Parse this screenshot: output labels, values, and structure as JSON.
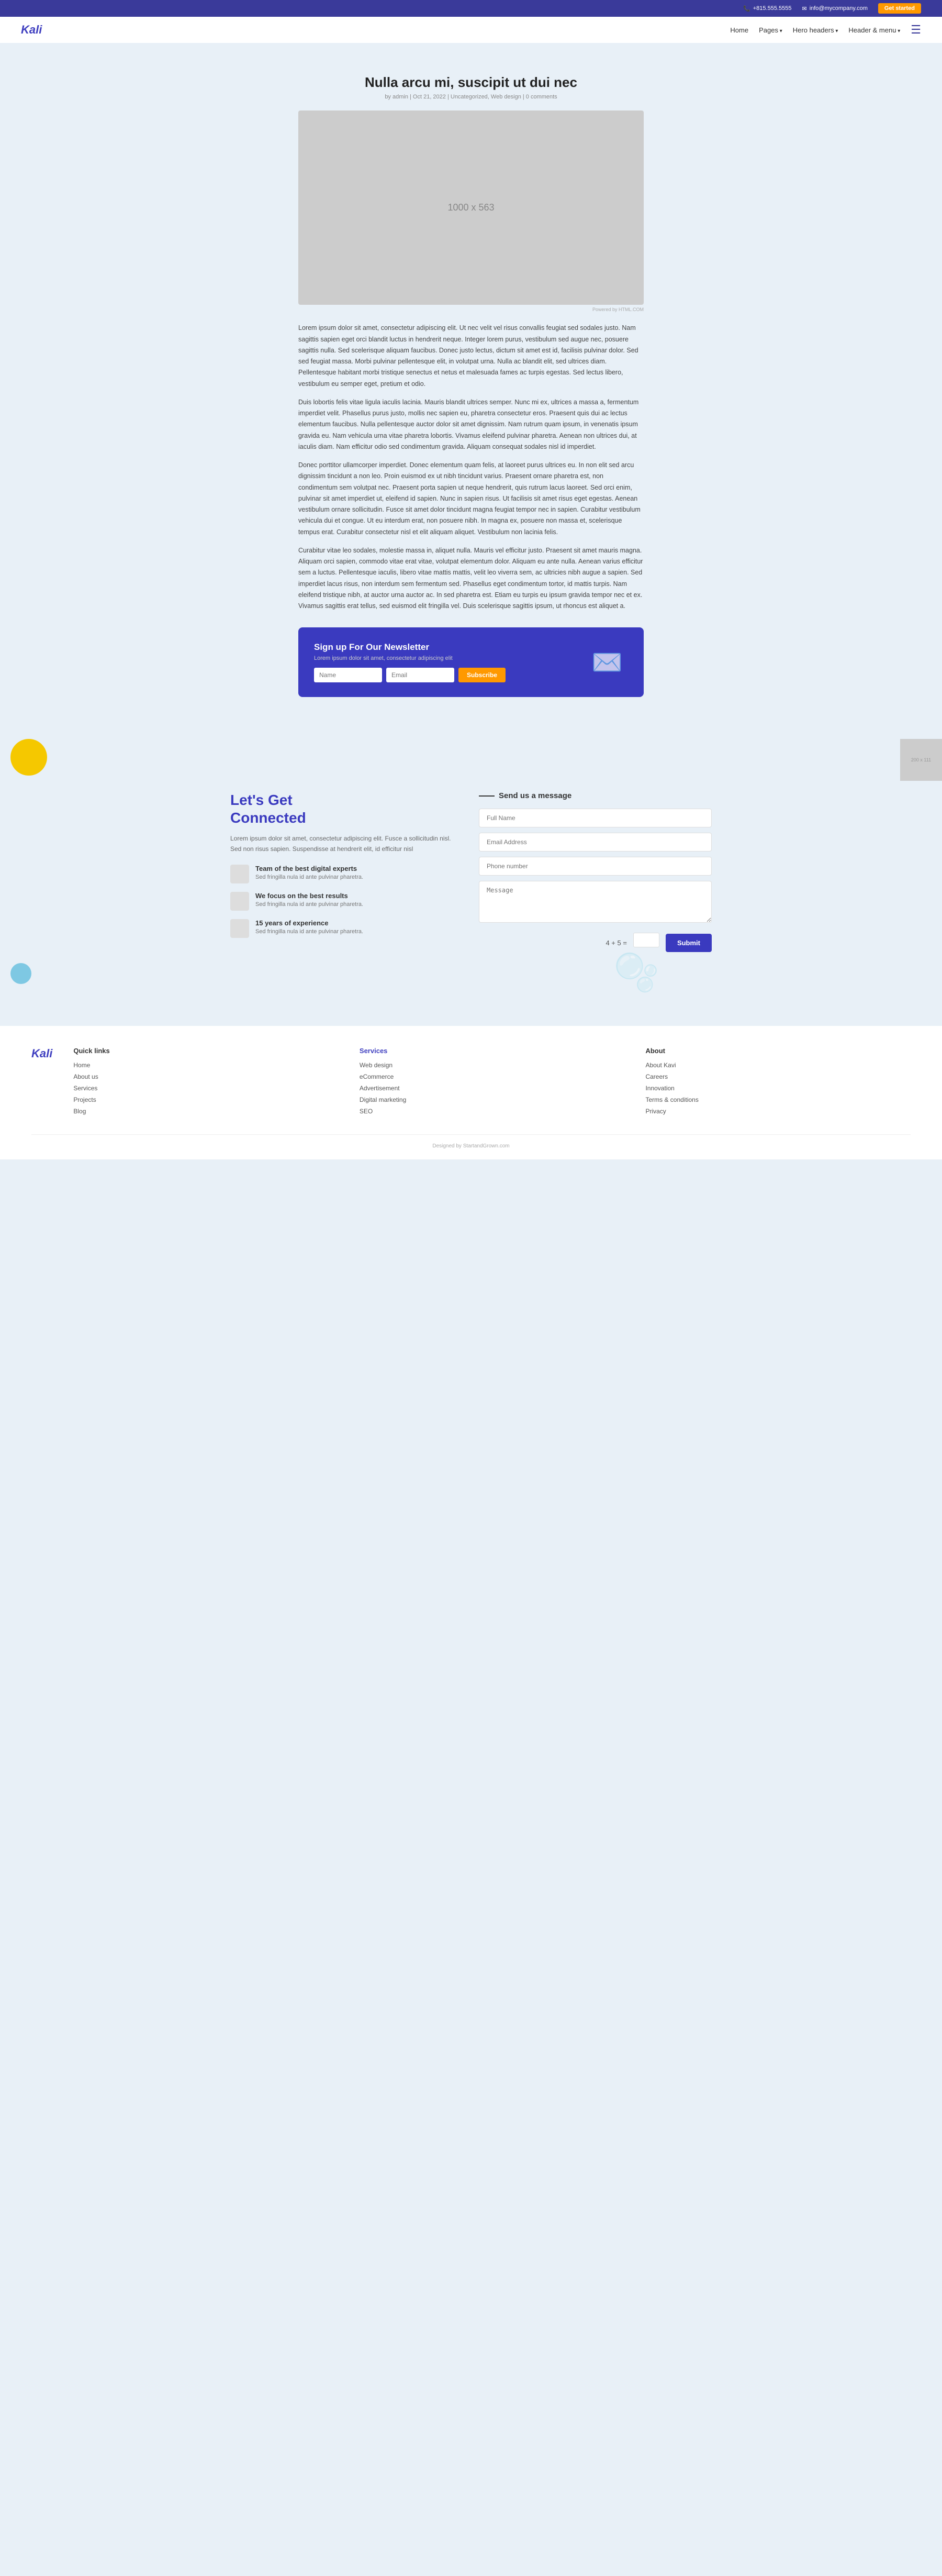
{
  "topbar": {
    "phone": "+815.555.5555",
    "email": "info@mycompany.com",
    "cta_label": "Get started",
    "phone_icon": "📞",
    "email_icon": "✉"
  },
  "navbar": {
    "logo": "Kali",
    "links": [
      {
        "label": "Home",
        "has_arrow": false
      },
      {
        "label": "Pages",
        "has_arrow": true
      },
      {
        "label": "Hero headers",
        "has_arrow": true
      },
      {
        "label": "Header & menu",
        "has_arrow": true
      }
    ],
    "hamburger_icon": "☰"
  },
  "post": {
    "title": "Nulla arcu mi, suscipit ut dui nec",
    "meta": "by admin | Oct 21, 2022 | Uncategorized, Web design | 0 comments",
    "image_label": "1000 x 563",
    "image_credit": "Powered by HTML.COM",
    "paragraphs": [
      "Lorem ipsum dolor sit amet, consectetur adipiscing elit. Ut nec velit vel risus convallis feugiat sed sodales justo. Nam sagittis sapien eget orci blandit luctus in hendrerit neque. Integer lorem purus, vestibulum sed augue nec, posuere sagittis nulla. Sed scelerisque aliquam faucibus. Donec justo lectus, dictum sit amet est id, facilisis pulvinar dolor. Sed sed feugiat massa. Morbi pulvinar pellentesque elit, in volutpat urna. Nulla ac blandit elit, sed ultrices diam. Pellentesque habitant morbi tristique senectus et netus et malesuada fames ac turpis egestas. Sed lectus libero, vestibulum eu semper eget, pretium et odio.",
      "Duis lobortis felis vitae ligula iaculis lacinia. Mauris blandit ultrices semper. Nunc mi ex, ultrices a massa a, fermentum imperdiet velit. Phasellus purus justo, mollis nec sapien eu, pharetra consectetur eros. Praesent quis dui ac lectus elementum faucibus. Nulla pellentesque auctor dolor sit amet dignissim. Nam rutrum quam ipsum, in venenatis ipsum gravida eu. Nam vehicula urna vitae pharetra lobortis. Vivamus eleifend pulvinar pharetra. Aenean non ultrices dui, at iaculis diam. Nam efficitur odio sed condimentum gravida. Aliquam consequat sodales nisl id imperdiet.",
      "Donec porttitor ullamcorper imperdiet. Donec elementum quam felis, at laoreet purus ultrices eu. In non elit sed arcu dignissim tincidunt a non leo. Proin euismod ex ut nibh tincidunt varius. Praesent ornare pharetra est, non condimentum sem volutpat nec. Praesent porta sapien ut neque hendrerit, quis rutrum lacus laoreet. Sed orci enim, pulvinar sit amet imperdiet ut, eleifend id sapien. Nunc in sapien risus. Ut facilisis sit amet risus eget egestas. Aenean vestibulum ornare sollicitudin. Fusce sit amet dolor tincidunt magna feugiat tempor nec in sapien. Curabitur vestibulum vehicula dui et congue. Ut eu interdum erat, non posuere nibh. In magna ex, posuere non massa et, scelerisque tempus erat. Curabitur consectetur nisl et elit aliquam aliquet. Vestibulum non lacinia felis.",
      "Curabitur vitae leo sodales, molestie massa in, aliquet nulla. Mauris vel efficitur justo. Praesent sit amet mauris magna. Aliquam orci sapien, commodo vitae erat vitae, volutpat elementum dolor. Aliquam eu ante nulla. Aenean varius efficitur sem a luctus. Pellentesque iaculis, libero vitae mattis mattis, velit leo viverra sem, ac ultricies nibh augue a sapien. Sed imperdiet lacus risus, non interdum sem fermentum sed. Phasellus eget condimentum tortor, id mattis turpis. Nam eleifend tristique nibh, at auctor urna auctor ac. In sed pharetra est. Etiam eu turpis eu ipsum gravida tempor nec et ex. Vivamus sagittis erat tellus, sed euismod elit fringilla vel. Duis scelerisque sagittis ipsum, ut rhoncus est aliquet a."
    ]
  },
  "newsletter": {
    "title": "Sign up For Our Newsletter",
    "desc": "Lorem ipsum dolor sit amet, consectetur adipiscing elit",
    "name_placeholder": "Name",
    "email_placeholder": "Email",
    "subscribe_label": "Subscribe",
    "illustration": "✉"
  },
  "connected_section": {
    "heading_line1": "Let's Get",
    "heading_line2": "Connected",
    "description": "Lorem ipsum dolor sit amet, consectetur adipiscing elit. Fusce a sollicitudin nisl. Sed non risus sapien. Suspendisse at hendrerit elit, id efficitur nisl",
    "features": [
      {
        "title": "Team of the best digital experts",
        "desc": "Sed fringilla nula id ante pulvinar pharetra."
      },
      {
        "title": "We focus on the best results",
        "desc": "Sed fringilla nula id ante pulvinar pharetra."
      },
      {
        "title": "15 years of experience",
        "desc": "Sed fringilla nula id ante pulvinar pharetra."
      }
    ]
  },
  "contact_form": {
    "title": "Send us a message",
    "full_name_placeholder": "Full Name",
    "email_placeholder": "Email Address",
    "phone_placeholder": "Phone number",
    "message_placeholder": "Message",
    "captcha": "4 + 5 =",
    "submit_label": "Submit"
  },
  "footer": {
    "logo": "Kali",
    "columns": [
      {
        "heading": "Quick links",
        "color": "dark",
        "items": [
          "Home",
          "About us",
          "Services",
          "Projects",
          "Blog"
        ]
      },
      {
        "heading": "Services",
        "color": "blue",
        "items": [
          "Web design",
          "eCommerce",
          "Advertisement",
          "Digital marketing",
          "SEO"
        ]
      },
      {
        "heading": "About",
        "color": "dark",
        "items": [
          "About Kavi",
          "Careers",
          "Innovation",
          "Terms & conditions",
          "Privacy"
        ]
      }
    ],
    "credit": "Designed by StartandGrown.com"
  }
}
